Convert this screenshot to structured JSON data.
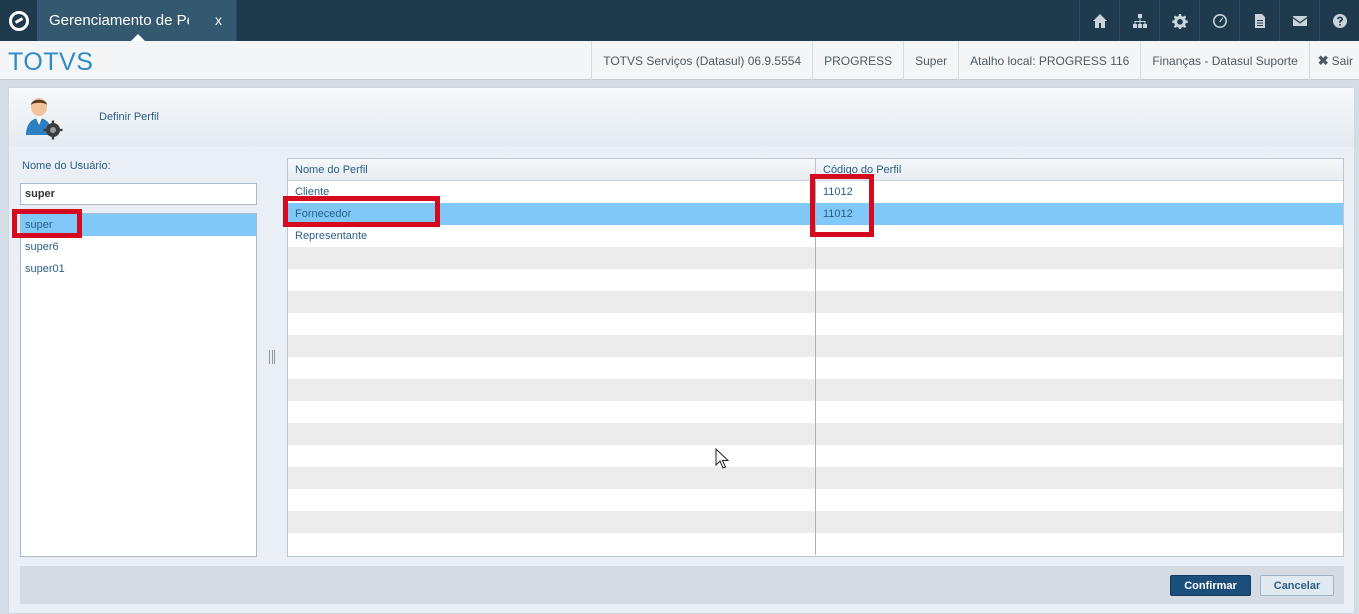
{
  "window": {
    "tab_title": "Gerenciamento de Perfil",
    "tab_close": "x"
  },
  "topbar": {
    "icons": [
      "home-icon",
      "sitemap-icon",
      "gear-icon",
      "clock-icon",
      "document-icon",
      "mail-icon",
      "help-icon"
    ]
  },
  "appbar": {
    "brand": "TOTVS",
    "version": "TOTVS Serviços (Datasul) 06.9.5554",
    "database": "PROGRESS",
    "user": "Super",
    "shortcut": "Atalho local: PROGRESS 116",
    "company": "Finanças - Datasul Suporte",
    "exit_label": "Sair"
  },
  "panel": {
    "title": "Definir Perfil",
    "user_label": "Nome do Usuário:",
    "user_input_value": "super",
    "users": [
      {
        "name": "super",
        "selected": true
      },
      {
        "name": "super6",
        "selected": false
      },
      {
        "name": "super01",
        "selected": false
      }
    ]
  },
  "grid": {
    "headers": {
      "name": "Nome do Perfil",
      "code": "Código do Perfil"
    },
    "rows": [
      {
        "name": "Cliente",
        "code": "11012",
        "selected": false
      },
      {
        "name": "Fornecedor",
        "code": "11012",
        "selected": true
      },
      {
        "name": "Representante",
        "code": "",
        "selected": false
      }
    ],
    "total_visible_rows": 17
  },
  "footer": {
    "confirm_label": "Confirmar",
    "cancel_label": "Cancelar"
  },
  "colors": {
    "topbar": "#1f3a4d",
    "brand": "#2d8bc5",
    "selection": "#7fc8f8",
    "highlight": "#d40b1e",
    "confirm": "#1c4e7c"
  }
}
